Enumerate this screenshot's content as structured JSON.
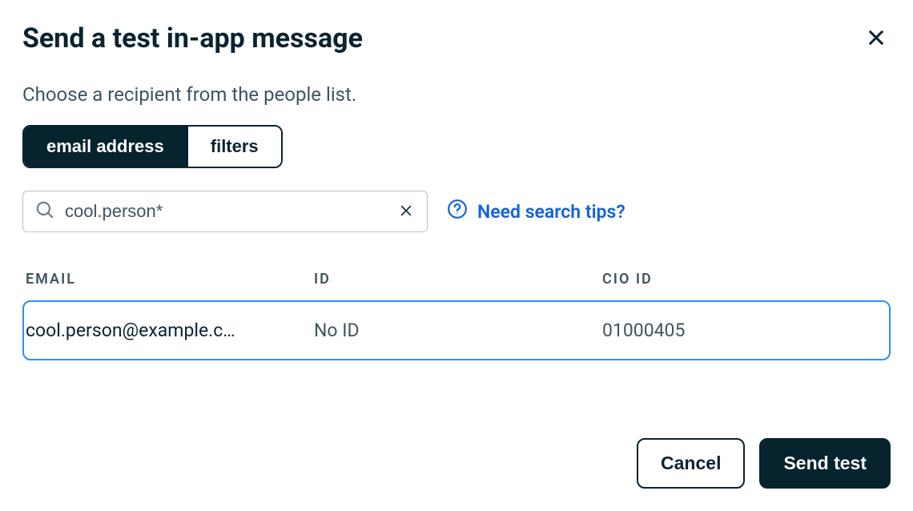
{
  "modal": {
    "title": "Send a test in-app message",
    "subtitle": "Choose a recipient from the people list."
  },
  "segmented": {
    "email_address": "email address",
    "filters": "filters"
  },
  "search": {
    "value": "cool.person*",
    "placeholder": "",
    "help_link": "Need search tips?"
  },
  "table": {
    "headers": {
      "email": "EMAIL",
      "id": "ID",
      "cio_id": "CIO ID"
    },
    "rows": [
      {
        "email": "cool.person@example.c…",
        "id": "No ID",
        "cio_id": "01000405"
      }
    ]
  },
  "footer": {
    "cancel": "Cancel",
    "send_test": "Send test"
  }
}
